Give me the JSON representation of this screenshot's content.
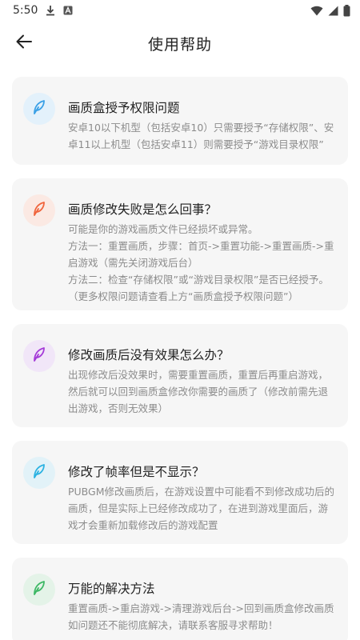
{
  "status_bar": {
    "time": "5:50",
    "icons": [
      "download-icon",
      "a-icon",
      "wifi-icon",
      "signal-icon",
      "battery-icon"
    ]
  },
  "header": {
    "title": "使用帮助",
    "back_icon": "arrow-left-icon"
  },
  "items": [
    {
      "title": "画质盒授予权限问题",
      "desc": "安卓10以下机型（包括安卓10）只需要授予“存储权限”、安卓11以上机型（包括安卓11）则需要授予“游戏目录权限”",
      "icon": "feather-icon",
      "icon_color": "#3aa0e6",
      "icon_bg": "#e3f1fb"
    },
    {
      "title": "画质修改失败是怎么回事？",
      "desc": "可能是你的游戏画质文件已经损坏或异常。\n方法一：重置画质，步骤：首页->重置功能->重置画质->重启游戏（需先关闭游戏后台）\n方法二：检查“存储权限”或“游戏目录权限”是否已经授予。（更多权限问题请查看上方“画质盒授予权限问题”）",
      "icon": "feather-icon",
      "icon_color": "#f0643c",
      "icon_bg": "#fbe9e3"
    },
    {
      "title": "修改画质后没有效果怎么办？",
      "desc": "出现修改后没效果时，需要重置画质，重置后再重启游戏，然后就可以回到画质盒修改你需要的画质了（修改前需先退出游戏，否则无效果）",
      "icon": "feather-icon",
      "icon_color": "#a43ad8",
      "icon_bg": "#f1e6f8"
    },
    {
      "title": "修改了帧率但是不显示？",
      "desc": "PUBGM修改画质后，在游戏设置中可能看不到修改成功后的画质，但是实际上已经修改成功了，在进到游戏里面后，游戏才会重新加载修改后的游戏配置",
      "icon": "feather-icon",
      "icon_color": "#2bb2e2",
      "icon_bg": "#e2f2f8"
    },
    {
      "title": "万能的解决方法",
      "desc": "重置画质->重启游戏->清理游戏后台->回到画质盒修改画质\n如问题还不能彻底解决，请联系客服寻求帮助！",
      "icon": "feather-icon",
      "icon_color": "#3cb864",
      "icon_bg": "#e4f3e8"
    }
  ]
}
